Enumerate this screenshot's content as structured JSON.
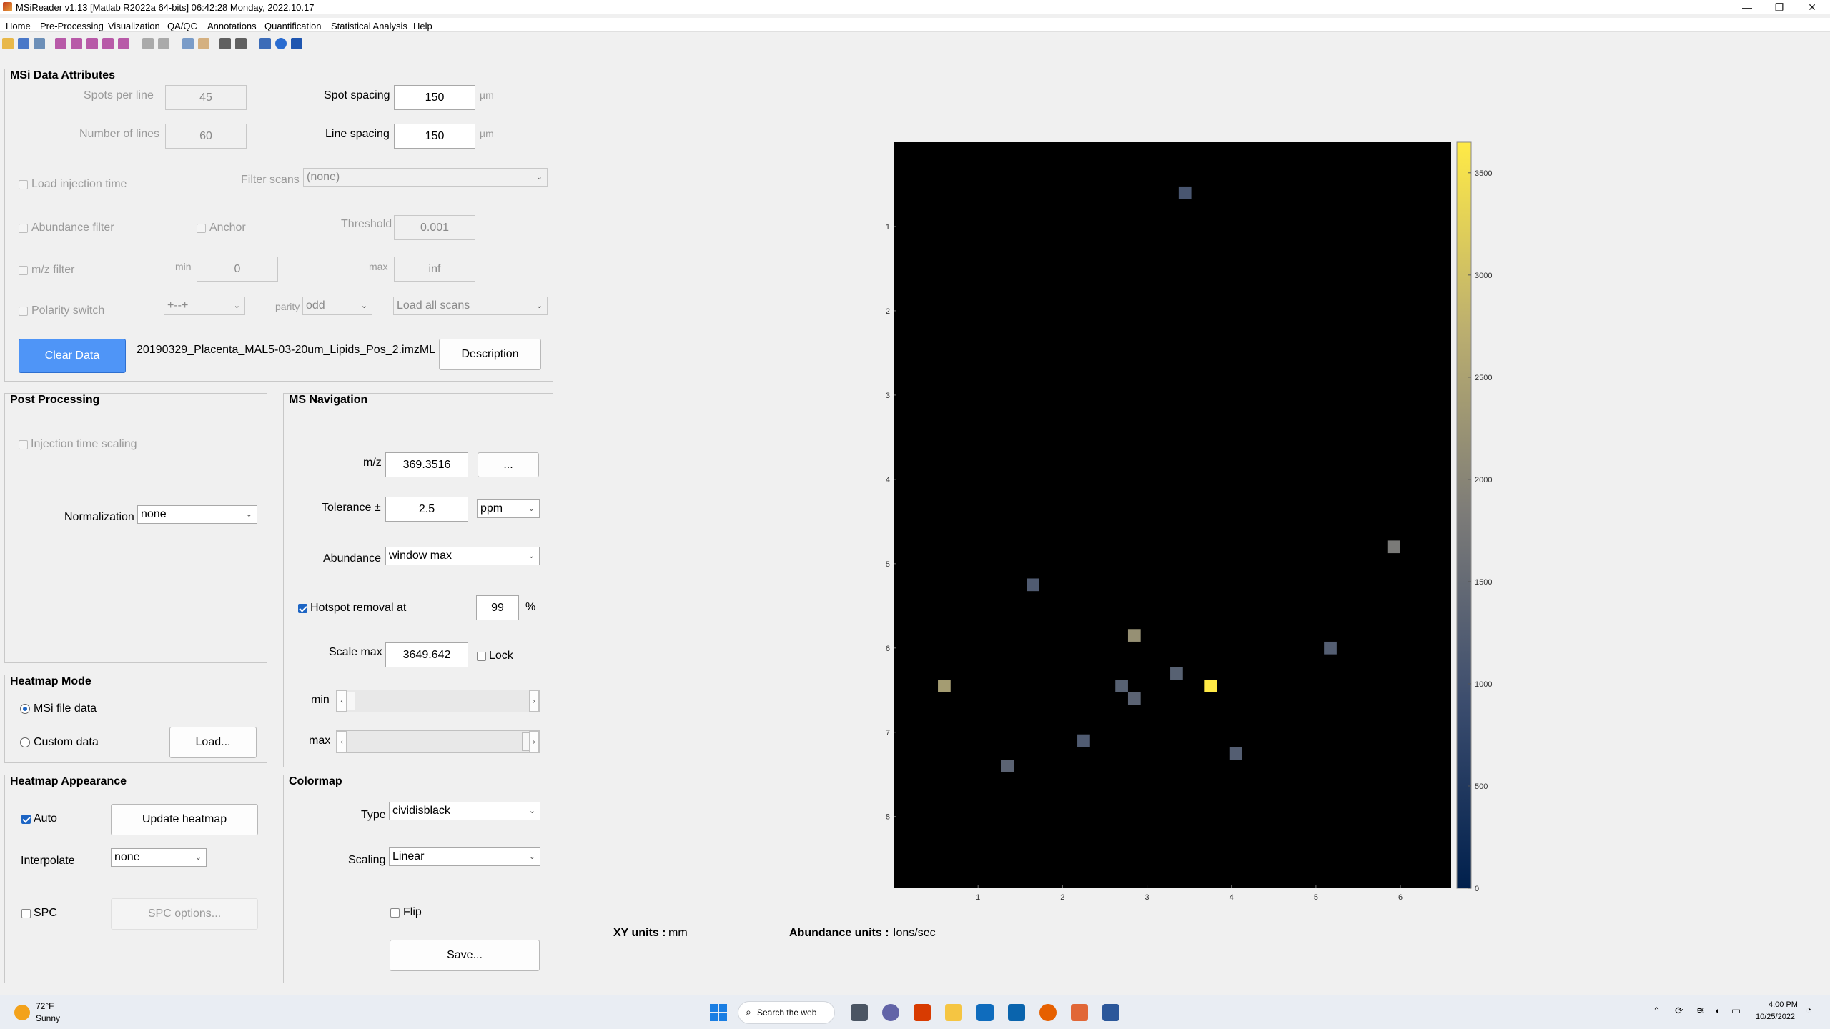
{
  "window": {
    "title": "MSiReader  v1.13  [Matlab R2022a 64-bits]  06:42:28 Monday, 2022.10.17"
  },
  "menu": [
    "Home",
    "Pre-Processing",
    "Visualization",
    "QA/QC",
    "Annotations",
    "Quantification",
    "Statistical Analysis",
    "Help"
  ],
  "msi": {
    "title": "MSi Data Attributes",
    "spots_per_line_label": "Spots per line",
    "spots_per_line": "45",
    "number_of_lines_label": "Number of lines",
    "number_of_lines": "60",
    "spot_spacing_label": "Spot spacing",
    "spot_spacing": "150",
    "line_spacing_label": "Line spacing",
    "line_spacing": "150",
    "unit_um": "µm",
    "load_injection_label": "Load injection time",
    "filter_scans_label": "Filter scans",
    "filter_scans_value": "(none)",
    "abundance_filter_label": "Abundance filter",
    "anchor_label": "Anchor",
    "threshold_label": "Threshold",
    "threshold": "0.001",
    "mz_filter_label": "m/z filter",
    "min_label": "min",
    "min_value": "0",
    "max_label": "max",
    "max_value": "inf",
    "polarity_label": "Polarity switch",
    "polarity_value": "+--+",
    "parity_label": "parity",
    "parity_value": "odd",
    "scans_value": "Load all scans",
    "clear_label": "Clear Data",
    "filename": "20190329_Placenta_MAL5-03-20um_Lipids_Pos_2.imzML",
    "description_label": "Description"
  },
  "post": {
    "title": "Post Processing",
    "injection_scaling_label": "Injection time scaling",
    "normalization_label": "Normalization",
    "normalization_value": "none"
  },
  "nav": {
    "title": "MS Navigation",
    "mz_label": "m/z",
    "mz_value": "369.3516",
    "dots_label": "...",
    "tolerance_label": "Tolerance ±",
    "tolerance_value": "2.5",
    "tolerance_unit": "ppm",
    "abundance_label": "Abundance",
    "abundance_value": "window max",
    "hotspot_label": "Hotspot removal at",
    "hotspot_value": "99",
    "percent": "%",
    "scale_max_label": "Scale max",
    "scale_max_value": "3649.642",
    "lock_label": "Lock",
    "min_label": "min",
    "max_label": "max",
    "min_fraction": 0.0,
    "max_fraction": 1.0
  },
  "heatmap_mode": {
    "title": "Heatmap Mode",
    "msi_label": "MSi file data",
    "custom_label": "Custom data",
    "load_label": "Load..."
  },
  "appearance": {
    "title": "Heatmap Appearance",
    "auto_label": "Auto",
    "update_label": "Update heatmap",
    "interpolate_label": "Interpolate",
    "interpolate_value": "none",
    "spc_label": "SPC",
    "spc_options_label": "SPC options..."
  },
  "colormap": {
    "title": "Colormap",
    "type_label": "Type",
    "type_value": "cividisblack",
    "scaling_label": "Scaling",
    "scaling_value": "Linear",
    "flip_label": "Flip",
    "save_label": "Save..."
  },
  "units": {
    "xy_label": "XY units :",
    "xy_value": "mm",
    "abundance_label": "Abundance units :",
    "abundance_value": "Ions/sec"
  },
  "chart_data": {
    "type": "heatmap",
    "title": "",
    "xlabel": "",
    "ylabel": "",
    "xlim": [
      0,
      6.6
    ],
    "ylim": [
      0,
      8.85
    ],
    "x_ticks": [
      "1",
      "2",
      "3",
      "4",
      "5",
      "6"
    ],
    "y_ticks": [
      "1",
      "2",
      "3",
      "4",
      "5",
      "6",
      "7",
      "8"
    ],
    "colorbar_ticks": [
      "0",
      "500",
      "1000",
      "1500",
      "2000",
      "2500",
      "3000",
      "3500"
    ],
    "colorbar_range": [
      0,
      3649.642
    ],
    "colormap": "cividisblack",
    "background": "#000000",
    "hotspots": [
      {
        "x": 3.45,
        "y": 0.6,
        "value": 1100
      },
      {
        "x": 5.92,
        "y": 4.8,
        "value": 1800
      },
      {
        "x": 1.65,
        "y": 5.25,
        "value": 1200
      },
      {
        "x": 2.85,
        "y": 5.85,
        "value": 2200
      },
      {
        "x": 5.17,
        "y": 6.0,
        "value": 1250
      },
      {
        "x": 3.35,
        "y": 6.3,
        "value": 1300
      },
      {
        "x": 0.6,
        "y": 6.45,
        "value": 2400
      },
      {
        "x": 2.7,
        "y": 6.45,
        "value": 1300
      },
      {
        "x": 3.75,
        "y": 6.45,
        "value": 3650
      },
      {
        "x": 2.85,
        "y": 6.6,
        "value": 1350
      },
      {
        "x": 2.25,
        "y": 7.1,
        "value": 1200
      },
      {
        "x": 4.05,
        "y": 7.25,
        "value": 1250
      },
      {
        "x": 1.35,
        "y": 7.4,
        "value": 1350
      }
    ]
  },
  "taskbar": {
    "weather_temp": "72°F",
    "weather_desc": "Sunny",
    "search": "Search the web",
    "time": "4:00 PM",
    "date": "10/25/2022"
  }
}
